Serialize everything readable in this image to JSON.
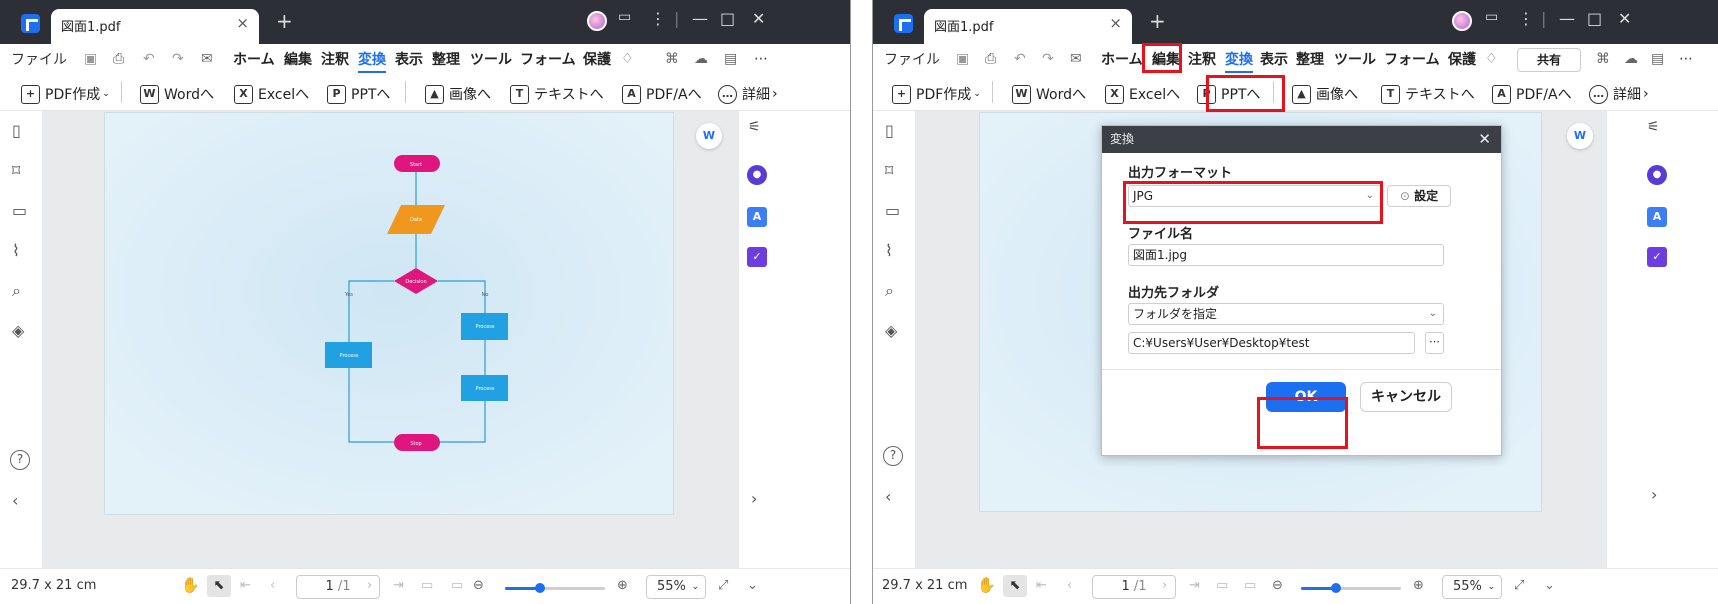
{
  "window": {
    "tab_title": "図面1.pdf",
    "menu": [
      "ファイル",
      "ホーム",
      "編集",
      "注釈",
      "変換",
      "表示",
      "整理",
      "ツール",
      "フォーム",
      "保護"
    ],
    "share_label": "共有",
    "toolbar": [
      "PDF作成",
      "Wordへ",
      "Excelへ",
      "PPTへ",
      "画像へ",
      "テキストへ",
      "PDF/Aへ",
      "詳細"
    ],
    "toolbar_icons": [
      "plus-doc-icon",
      "word-icon",
      "excel-icon",
      "ppt-icon",
      "image-icon",
      "text-icon",
      "pdfa-icon",
      "more-icon"
    ],
    "status_size": "29.7 x 21 cm",
    "page_current": "1",
    "page_total": "/1",
    "zoom": "55%",
    "zoom_fraction": 0.35
  },
  "flowchart": {
    "start": "Start",
    "data": "Data",
    "decision": "Decision",
    "yes": "Yes",
    "no": "No",
    "process_left": "Process",
    "process_right_1": "Process",
    "process_right_2": "Process",
    "stop": "Stop"
  },
  "dialog": {
    "title": "変換",
    "output_format_label": "出力フォーマット",
    "output_format_value": "JPG",
    "settings_label": "設定",
    "filename_label": "ファイル名",
    "filename_value": "図面1.jpg",
    "folder_label": "出力先フォルダ",
    "folder_option": "フォルダを指定",
    "folder_path": "C:¥Users¥User¥Desktop¥test",
    "ok_label": "OK",
    "cancel_label": "キャンセル"
  },
  "colors": {
    "accent": "#1d6ff2",
    "highlight": "#e8121c",
    "flow_pink": "#e0157d",
    "flow_orange": "#f0971d",
    "flow_blue": "#21a1e1",
    "titlebar": "#2c2f35"
  }
}
